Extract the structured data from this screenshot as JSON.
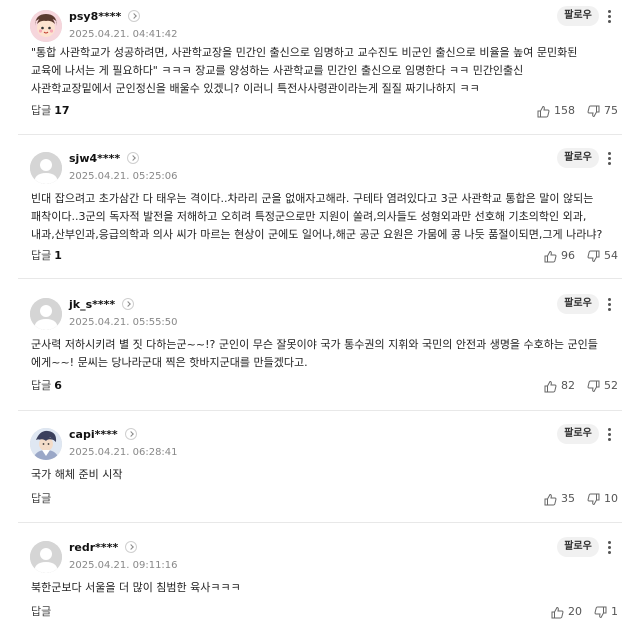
{
  "follow_label": "팔로우",
  "reply_label": "답글",
  "comments": [
    {
      "username": "psy8****",
      "date": "2025.04.21. 04:41:42",
      "avatar": "boy-face-avatar",
      "text": "\"통합 사관학교가 성공하려면, 사관학교장을 민간인 출신으로 임명하고 교수진도 비군인 출신으로 비율을 높여 문민화된\n교육에 나서는 게 필요하다\" ㅋㅋㅋ 장교를 양성하는 사관학교를 민간인 출신으로 임명한다 ㅋㅋ 민간인출신\n사관학교장밑에서 군인정신을 배울수 있겠니? 이러니 특전사사령관이라는게 질질 짜기나하지 ㅋㅋ",
      "reply_count": "17",
      "likes": "158",
      "dislikes": "75"
    },
    {
      "username": "sjw4****",
      "date": "2025.04.21. 05:25:06",
      "avatar": "default-user-avatar",
      "text": "빈대 잡으려고 초가삼간 다 태우는 격이다..차라리 군을 없애자고해라. 구테타 염려있다고 3군 사관학교 통합은 말이 않되는\n패착이다..3군의 독자적 발전을 저해하고 오히려 특정군으로만 지원이 쏠려,의사들도 성형외과만 선호해 기초의학인 외과,\n내과,산부인과,응급의학과 의사 씨가 마르는 현상이 군에도 일어나,해군 공군 요원은 가뭄에 콩 나듯 품절이되면,그게 나라냐?",
      "reply_count": "1",
      "likes": "96",
      "dislikes": "54"
    },
    {
      "username": "jk_s****",
      "date": "2025.04.21. 05:55:50",
      "avatar": "default-user-avatar",
      "text": "군사력 저하시키려 별 짓 다하는군~~!? 군인이 무슨 잘못이야 국가 통수권의 지휘와 국민의 안전과 생명을 수호하는 군인들\n에게~~! 문씨는 당나라군대 찍은 핫바지군대를 만들겠다고.",
      "reply_count": "6",
      "likes": "82",
      "dislikes": "52"
    },
    {
      "username": "capi****",
      "date": "2025.04.21. 06:28:41",
      "avatar": "character-avatar",
      "text": "국가 해체 준비 시작",
      "reply_count": "",
      "likes": "35",
      "dislikes": "10"
    },
    {
      "username": "redr****",
      "date": "2025.04.21. 09:11:16",
      "avatar": "default-user-avatar",
      "text": "북한군보다 서울을 더 많이 침범한 육사ㅋㅋㅋ",
      "reply_count": "",
      "likes": "20",
      "dislikes": "1"
    }
  ]
}
